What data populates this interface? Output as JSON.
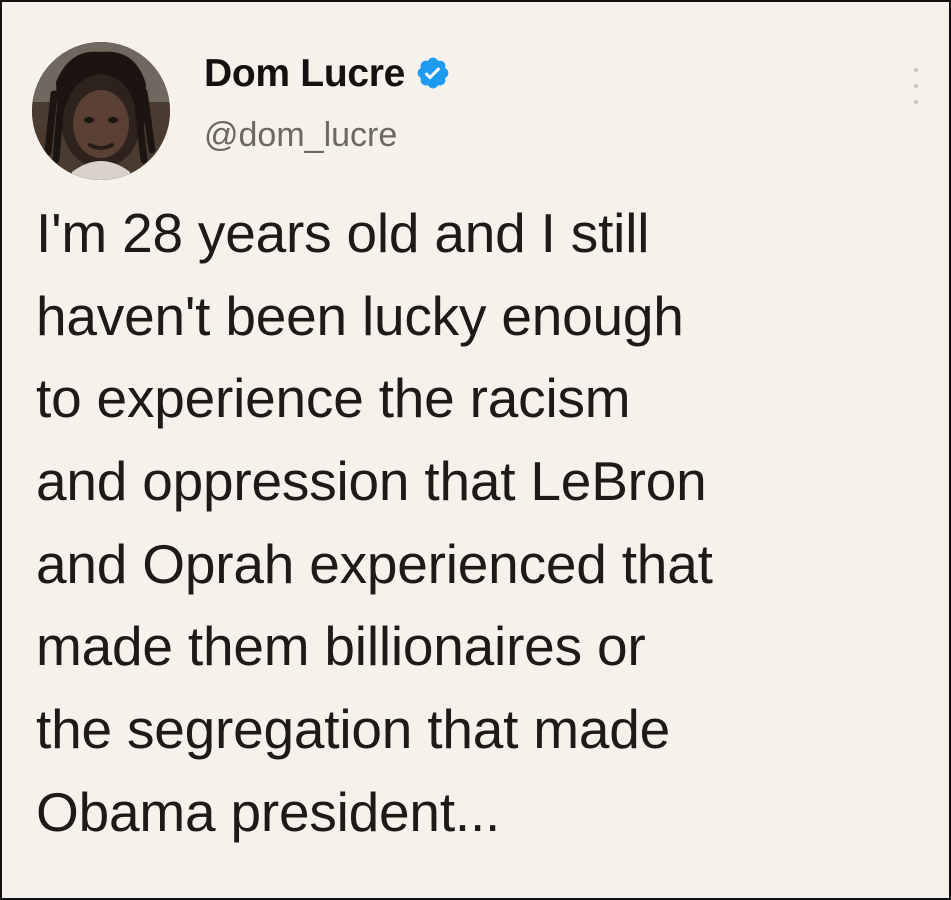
{
  "tweet": {
    "author": {
      "display_name": "Dom Lucre",
      "handle": "@dom_lucre",
      "verified": true,
      "avatar_icon": "profile-photo"
    },
    "body_lines": [
      "I'm 28 years old and I still",
      "haven't been lucky enough",
      "to experience the racism",
      "and oppression that LeBron",
      "and Oprah experienced that",
      "made them billionaires or",
      "the segregation that made",
      "Obama president..."
    ],
    "more_icon": "vertical-ellipsis-icon"
  },
  "colors": {
    "background": "#f6f1ea",
    "text": "#1d1a17",
    "handle": "#6f6861",
    "verified_badge": "#1d9bf0"
  }
}
